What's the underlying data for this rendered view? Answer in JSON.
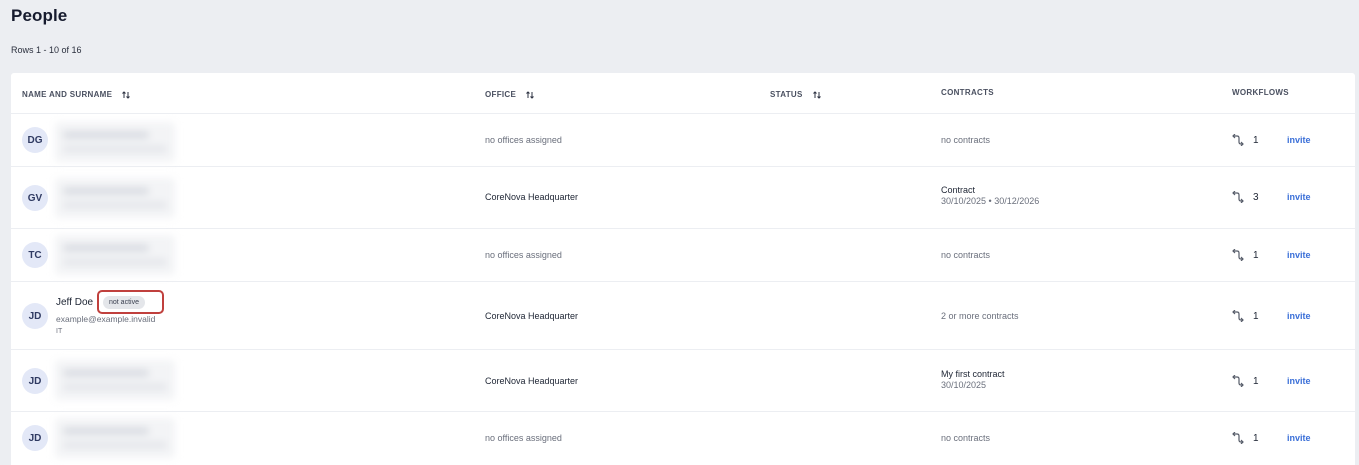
{
  "page": {
    "title": "People",
    "rows_count": "Rows 1 - 10 of 16"
  },
  "table": {
    "headers": {
      "name": "NAME AND SURNAME",
      "office": "OFFICE",
      "status": "STATUS",
      "contracts": "CONTRACTS",
      "workflows": "WORKFLOWS"
    },
    "sortable": [
      "name",
      "office",
      "status"
    ],
    "rows": [
      {
        "initials": "DG",
        "name": "",
        "email": "",
        "department": "",
        "badge": "",
        "office": "no offices assigned",
        "office_assigned": false,
        "contract_title": "no contracts",
        "contract_dates": "",
        "workflow_count": "1",
        "invite_label": "invite",
        "blurred": true
      },
      {
        "initials": "GV",
        "name": "",
        "email": "",
        "department": "",
        "badge": "",
        "office": "CoreNova Headquarter",
        "office_assigned": true,
        "contract_title": "Contract",
        "contract_dates": "30/10/2025 • 30/12/2026",
        "workflow_count": "3",
        "invite_label": "invite",
        "blurred": true
      },
      {
        "initials": "TC",
        "name": "",
        "email": "",
        "department": "",
        "badge": "",
        "office": "no offices assigned",
        "office_assigned": false,
        "contract_title": "no contracts",
        "contract_dates": "",
        "workflow_count": "1",
        "invite_label": "invite",
        "blurred": true
      },
      {
        "initials": "JD",
        "name": "Jeff Doe",
        "email": "example@example.invalid",
        "department": "IT",
        "badge": "not active",
        "office": "CoreNova Headquarter",
        "office_assigned": true,
        "contract_title": "2 or more contracts",
        "contract_dates": "",
        "workflow_count": "1",
        "invite_label": "invite",
        "blurred": false
      },
      {
        "initials": "JD",
        "name": "",
        "email": "",
        "department": "",
        "badge": "",
        "office": "CoreNova Headquarter",
        "office_assigned": true,
        "contract_title": "My first contract",
        "contract_dates": "30/10/2025",
        "workflow_count": "1",
        "invite_label": "invite",
        "blurred": true
      },
      {
        "initials": "JD",
        "name": "",
        "email": "",
        "department": "",
        "badge": "",
        "office": "no offices assigned",
        "office_assigned": false,
        "contract_title": "no contracts",
        "contract_dates": "",
        "workflow_count": "1",
        "invite_label": "invite",
        "blurred": true
      }
    ]
  },
  "icons": {
    "sort": "sort-icon",
    "workflow": "workflow-icon"
  },
  "colors": {
    "page_bg": "#eceef2",
    "avatar_bg": "#e3e8f7",
    "link": "#3a6fd8",
    "highlight": "#c0403d",
    "badge_bg": "#e4e6ea"
  }
}
